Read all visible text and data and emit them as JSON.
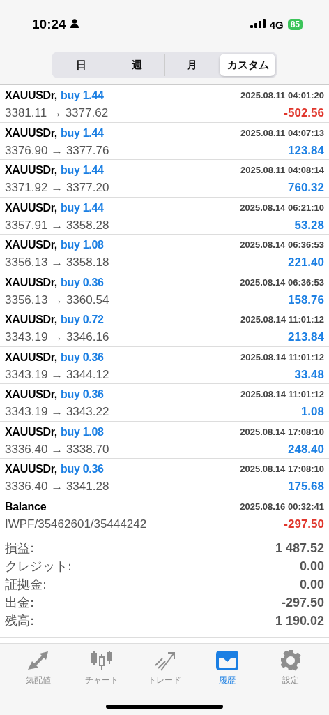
{
  "status_bar": {
    "time": "10:24",
    "network": "4G",
    "battery": "85"
  },
  "period_tabs": [
    {
      "label": "日",
      "selected": false
    },
    {
      "label": "週",
      "selected": false
    },
    {
      "label": "月",
      "selected": false
    },
    {
      "label": "カスタム",
      "selected": true
    }
  ],
  "deals": [
    {
      "kind": "trade",
      "symbol": "XAUUSDr,",
      "side": "buy 1.44",
      "time": "2025.08.11 04:01:20",
      "prices": "3381.11 → 3377.62",
      "profit": "-502.56",
      "color": "#e0362c"
    },
    {
      "kind": "trade",
      "symbol": "XAUUSDr,",
      "side": "buy 1.44",
      "time": "2025.08.11 04:07:13",
      "prices": "3376.90 → 3377.76",
      "profit": "123.84",
      "color": "#1b7fe3"
    },
    {
      "kind": "trade",
      "symbol": "XAUUSDr,",
      "side": "buy 1.44",
      "time": "2025.08.11 04:08:14",
      "prices": "3371.92 → 3377.20",
      "profit": "760.32",
      "color": "#1b7fe3"
    },
    {
      "kind": "trade",
      "symbol": "XAUUSDr,",
      "side": "buy 1.44",
      "time": "2025.08.14 06:21:10",
      "prices": "3357.91 → 3358.28",
      "profit": "53.28",
      "color": "#1b7fe3"
    },
    {
      "kind": "trade",
      "symbol": "XAUUSDr,",
      "side": "buy 1.08",
      "time": "2025.08.14 06:36:53",
      "prices": "3356.13 → 3358.18",
      "profit": "221.40",
      "color": "#1b7fe3"
    },
    {
      "kind": "trade",
      "symbol": "XAUUSDr,",
      "side": "buy 0.36",
      "time": "2025.08.14 06:36:53",
      "prices": "3356.13 → 3360.54",
      "profit": "158.76",
      "color": "#1b7fe3"
    },
    {
      "kind": "trade",
      "symbol": "XAUUSDr,",
      "side": "buy 0.72",
      "time": "2025.08.14 11:01:12",
      "prices": "3343.19 → 3346.16",
      "profit": "213.84",
      "color": "#1b7fe3"
    },
    {
      "kind": "trade",
      "symbol": "XAUUSDr,",
      "side": "buy 0.36",
      "time": "2025.08.14 11:01:12",
      "prices": "3343.19 → 3344.12",
      "profit": "33.48",
      "color": "#1b7fe3"
    },
    {
      "kind": "trade",
      "symbol": "XAUUSDr,",
      "side": "buy 0.36",
      "time": "2025.08.14 11:01:12",
      "prices": "3343.19 → 3343.22",
      "profit": "1.08",
      "color": "#1b7fe3"
    },
    {
      "kind": "trade",
      "symbol": "XAUUSDr,",
      "side": "buy 1.08",
      "time": "2025.08.14 17:08:10",
      "prices": "3336.40 → 3338.70",
      "profit": "248.40",
      "color": "#1b7fe3"
    },
    {
      "kind": "trade",
      "symbol": "XAUUSDr,",
      "side": "buy 0.36",
      "time": "2025.08.14 17:08:10",
      "prices": "3336.40 → 3341.28",
      "profit": "175.68",
      "color": "#1b7fe3"
    },
    {
      "kind": "balance",
      "symbol": "Balance",
      "time": "2025.08.16 00:32:41",
      "prices": "IWPF/35462601/35444242",
      "profit": "-297.50",
      "color": "#e0362c"
    }
  ],
  "summary": [
    {
      "label": "損益:",
      "value": "1 487.52"
    },
    {
      "label": "クレジット:",
      "value": "0.00"
    },
    {
      "label": "証拠金:",
      "value": "0.00"
    },
    {
      "label": "出金:",
      "value": "-297.50"
    },
    {
      "label": "残高:",
      "value": "1 190.02"
    }
  ],
  "tab_bar": [
    {
      "kind": "quotes",
      "label": "気配値",
      "selected": false
    },
    {
      "kind": "chart",
      "label": "チャート",
      "selected": false
    },
    {
      "kind": "trade",
      "label": "トレード",
      "selected": false
    },
    {
      "kind": "history",
      "label": "履歴",
      "selected": true
    },
    {
      "kind": "settings",
      "label": "設定",
      "selected": false
    }
  ]
}
